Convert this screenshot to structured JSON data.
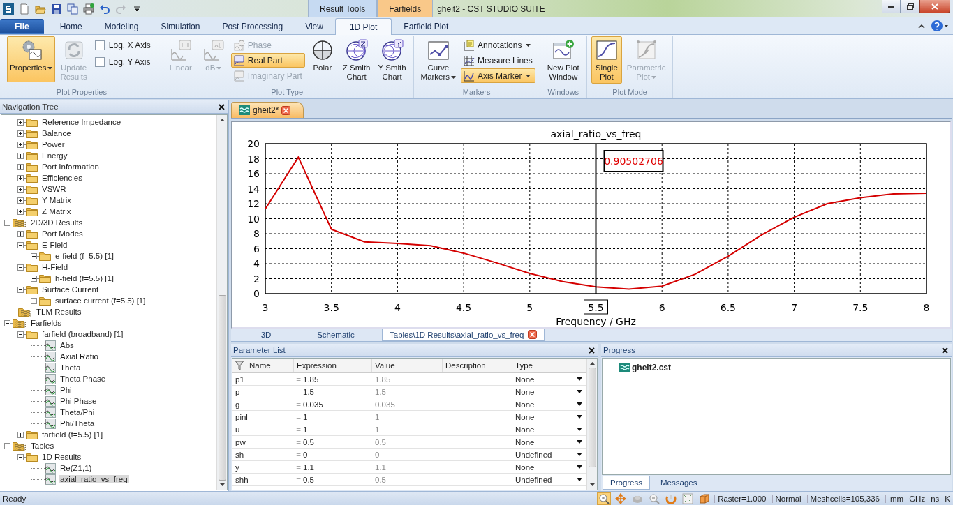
{
  "window": {
    "title": "gheit2 - CST STUDIO SUITE",
    "context_tabs": [
      {
        "label": "Result Tools",
        "color": "#c6daf2"
      },
      {
        "label": "Farfields",
        "color": "#f9c889"
      }
    ]
  },
  "ribbon_tabs": [
    {
      "label": "File",
      "kind": "file",
      "selected": false
    },
    {
      "label": "Home",
      "kind": "tab",
      "selected": false
    },
    {
      "label": "Modeling",
      "kind": "tab",
      "selected": false
    },
    {
      "label": "Simulation",
      "kind": "tab",
      "selected": false
    },
    {
      "label": "Post Processing",
      "kind": "tab",
      "selected": false
    },
    {
      "label": "View",
      "kind": "tab",
      "selected": false
    },
    {
      "label": "1D Plot",
      "kind": "tab",
      "selected": true
    },
    {
      "label": "Farfield Plot",
      "kind": "tab",
      "selected": false
    }
  ],
  "ribbon_groups": [
    {
      "title": "Plot Properties",
      "items": [
        {
          "kind": "large",
          "label": "Properties",
          "active": true,
          "disabled": false,
          "dropdown": true
        },
        {
          "kind": "large",
          "label": "Update\nResults",
          "active": false,
          "disabled": true,
          "dropdown": false
        },
        {
          "kind": "checks",
          "items": [
            {
              "label": "Log. X Axis",
              "checked": false
            },
            {
              "label": "Log. Y Axis",
              "checked": false
            }
          ]
        }
      ]
    },
    {
      "title": "Plot Type",
      "items": [
        {
          "kind": "large",
          "label": "Linear",
          "active": false,
          "disabled": true,
          "dropdown": false
        },
        {
          "kind": "large",
          "label": "dB",
          "active": false,
          "disabled": true,
          "dropdown": true
        },
        {
          "kind": "stack",
          "items": [
            {
              "label": "Phase",
              "active": false,
              "disabled": true,
              "dropdown": false
            },
            {
              "label": "Real Part",
              "active": true,
              "disabled": false,
              "dropdown": false
            },
            {
              "label": "Imaginary Part",
              "active": false,
              "disabled": true,
              "dropdown": false
            }
          ]
        },
        {
          "kind": "large",
          "label": "Polar",
          "active": false,
          "disabled": false,
          "dropdown": false
        },
        {
          "kind": "large",
          "label": "Z Smith\nChart",
          "active": false,
          "disabled": false,
          "dropdown": false
        },
        {
          "kind": "large",
          "label": "Y Smith\nChart",
          "active": false,
          "disabled": false,
          "dropdown": false
        }
      ]
    },
    {
      "title": "Markers",
      "items": [
        {
          "kind": "large",
          "label": "Curve\nMarkers",
          "active": false,
          "disabled": false,
          "dropdown": true
        },
        {
          "kind": "stack",
          "items": [
            {
              "label": "Annotations",
              "active": false,
              "disabled": false,
              "dropdown": true
            },
            {
              "label": "Measure Lines",
              "active": false,
              "disabled": false,
              "dropdown": false
            },
            {
              "label": "Axis Marker",
              "active": true,
              "disabled": false,
              "dropdown": true
            }
          ]
        }
      ]
    },
    {
      "title": "Windows",
      "items": [
        {
          "kind": "large",
          "label": "New Plot\nWindow",
          "active": false,
          "disabled": false,
          "dropdown": false
        }
      ]
    },
    {
      "title": "Plot Mode",
      "items": [
        {
          "kind": "large",
          "label": "Single\nPlot",
          "active": true,
          "disabled": false,
          "dropdown": false
        },
        {
          "kind": "large",
          "label": "Parametric\nPlot",
          "active": false,
          "disabled": true,
          "dropdown": true
        }
      ]
    }
  ],
  "navigation_tree": {
    "title": "Navigation Tree",
    "items": [
      {
        "children": [
          {
            "label": "Reference Impedance",
            "kind": "folder",
            "expanded": false,
            "selected": false
          },
          {
            "label": "Balance",
            "kind": "folder",
            "expanded": false,
            "selected": false
          },
          {
            "label": "Power",
            "kind": "folder",
            "expanded": false,
            "selected": false
          },
          {
            "label": "Energy",
            "kind": "folder",
            "expanded": false,
            "selected": false
          },
          {
            "label": "Port Information",
            "kind": "folder",
            "expanded": false,
            "selected": false
          },
          {
            "label": "Efficiencies",
            "kind": "folder",
            "expanded": false,
            "selected": false
          },
          {
            "label": "VSWR",
            "kind": "folder",
            "expanded": false,
            "selected": false
          },
          {
            "label": "Y Matrix",
            "kind": "folder",
            "expanded": false,
            "selected": false
          },
          {
            "label": "Z Matrix",
            "kind": "folder",
            "expanded": false,
            "selected": false
          }
        ]
      },
      {
        "label": "2D/3D Results",
        "kind": "results",
        "expanded": true,
        "selected": false,
        "children": [
          {
            "label": "Port Modes",
            "kind": "folder",
            "expanded": false,
            "selected": false
          },
          {
            "label": "E-Field",
            "kind": "folder",
            "expanded": true,
            "selected": false,
            "children": [
              {
                "label": "e-field (f=5.5) [1]",
                "kind": "folder",
                "expanded": false,
                "selected": false
              }
            ]
          },
          {
            "label": "H-Field",
            "kind": "folder",
            "expanded": true,
            "selected": false,
            "children": [
              {
                "label": "h-field (f=5.5) [1]",
                "kind": "folder",
                "expanded": false,
                "selected": false
              }
            ]
          },
          {
            "label": "Surface Current",
            "kind": "folder",
            "expanded": true,
            "selected": false,
            "children": [
              {
                "label": "surface current (f=5.5) [1]",
                "kind": "folder",
                "expanded": false,
                "selected": false
              }
            ]
          }
        ]
      },
      {
        "label": "TLM Results",
        "kind": "results",
        "selected": false
      },
      {
        "label": "Farfields",
        "kind": "results",
        "expanded": true,
        "selected": false,
        "children": [
          {
            "label": "farfield (broadband) [1]",
            "kind": "folder",
            "expanded": true,
            "selected": false,
            "children": [
              {
                "label": "Abs",
                "kind": "curve",
                "selected": false
              },
              {
                "label": "Axial Ratio",
                "kind": "curve",
                "selected": false
              },
              {
                "label": "Theta",
                "kind": "curve",
                "selected": false
              },
              {
                "label": "Theta Phase",
                "kind": "curve",
                "selected": false
              },
              {
                "label": "Phi",
                "kind": "curve",
                "selected": false
              },
              {
                "label": "Phi Phase",
                "kind": "curve",
                "selected": false
              },
              {
                "label": "Theta/Phi",
                "kind": "curve",
                "selected": false
              },
              {
                "label": "Phi/Theta",
                "kind": "curve",
                "selected": false
              }
            ]
          },
          {
            "label": "farfield (f=5.5) [1]",
            "kind": "folder",
            "expanded": false,
            "selected": false
          }
        ]
      },
      {
        "label": "Tables",
        "kind": "results",
        "expanded": true,
        "selected": false,
        "children": [
          {
            "label": "1D Results",
            "kind": "folder",
            "expanded": true,
            "selected": false,
            "children": [
              {
                "label": "Re(Z1,1)",
                "kind": "curve",
                "selected": false
              },
              {
                "label": "axial_ratio_vs_freq",
                "kind": "curve",
                "selected": true
              }
            ]
          }
        ]
      }
    ]
  },
  "document_tabs": [
    {
      "label": "gheit2*",
      "selected": true
    }
  ],
  "plot": {
    "chart_data": {
      "type": "line",
      "title": "axial_ratio_vs_freq",
      "xlabel": "Frequency / GHz",
      "x": [
        3,
        3.25,
        3.5,
        3.75,
        4,
        4.25,
        4.5,
        4.75,
        5,
        5.25,
        5.5,
        5.75,
        6,
        6.25,
        6.5,
        6.75,
        7,
        7.25,
        7.5,
        7.75,
        8
      ],
      "series": [
        {
          "color": "#d40000",
          "values": [
            11.3,
            18.2,
            8.6,
            6.9,
            6.7,
            6.4,
            5.4,
            4.1,
            2.7,
            1.6,
            0.9,
            0.6,
            1.0,
            2.6,
            5.0,
            7.8,
            10.2,
            12.0,
            12.8,
            13.3,
            13.4
          ]
        }
      ],
      "xlim": [
        3,
        8
      ],
      "ylim": [
        0,
        20
      ],
      "xticks": [
        3,
        3.5,
        4,
        4.5,
        5,
        5.5,
        6,
        6.5,
        7,
        7.5,
        8
      ],
      "yticks": [
        0,
        2,
        4,
        6,
        8,
        10,
        12,
        14,
        16,
        18,
        20
      ],
      "grid": true,
      "ref_lines": [
        {
          "axis": "x",
          "value": 5.5
        }
      ],
      "annotations": [
        "0.90502706"
      ]
    }
  },
  "view_tabs": [
    {
      "label": "3D",
      "selected": false,
      "closable": false
    },
    {
      "label": "Schematic",
      "selected": false,
      "closable": false
    },
    {
      "label": "Tables\\1D Results\\axial_ratio_vs_freq",
      "selected": true,
      "closable": true
    }
  ],
  "parameter_list": {
    "title": "Parameter List",
    "columns": [
      "Name",
      "Expression",
      "Value",
      "Description",
      "Type"
    ],
    "rows": [
      {
        "name": "p1",
        "operator": "=",
        "expression": "1.85",
        "value": "1.85",
        "type": "None"
      },
      {
        "name": "p",
        "operator": "=",
        "expression": "1.5",
        "value": "1.5",
        "type": "None"
      },
      {
        "name": "g",
        "operator": "=",
        "expression": "0.035",
        "value": "0.035",
        "type": "None"
      },
      {
        "name": "pinl",
        "operator": "=",
        "expression": "1",
        "value": "1",
        "type": "None"
      },
      {
        "name": "u",
        "operator": "=",
        "expression": "1",
        "value": "1",
        "type": "None"
      },
      {
        "name": "pw",
        "operator": "=",
        "expression": "0.5",
        "value": "0.5",
        "type": "None"
      },
      {
        "name": "sh",
        "operator": "=",
        "expression": "0",
        "value": "0",
        "type": "Undefined"
      },
      {
        "name": "y",
        "operator": "=",
        "expression": "1.1",
        "value": "1.1",
        "type": "None"
      },
      {
        "name": "shh",
        "operator": "=",
        "expression": "0.5",
        "value": "0.5",
        "type": "Undefined"
      }
    ]
  },
  "progress": {
    "title": "Progress",
    "items": [
      "gheit2.cst"
    ],
    "tabs": [
      {
        "label": "Progress",
        "selected": true
      },
      {
        "label": "Messages",
        "selected": false
      }
    ]
  },
  "status_bar": {
    "message": "Ready",
    "tools": [
      {
        "active": true
      },
      {
        "active": false
      },
      {
        "active": false
      },
      {
        "active": false
      },
      {
        "active": false
      },
      {
        "active": false
      },
      {
        "active": false
      }
    ],
    "fields": [
      "Raster=1.000",
      "Normal",
      "Meshcells=105,336"
    ],
    "units": [
      "mm",
      "GHz",
      "ns",
      "K"
    ]
  }
}
